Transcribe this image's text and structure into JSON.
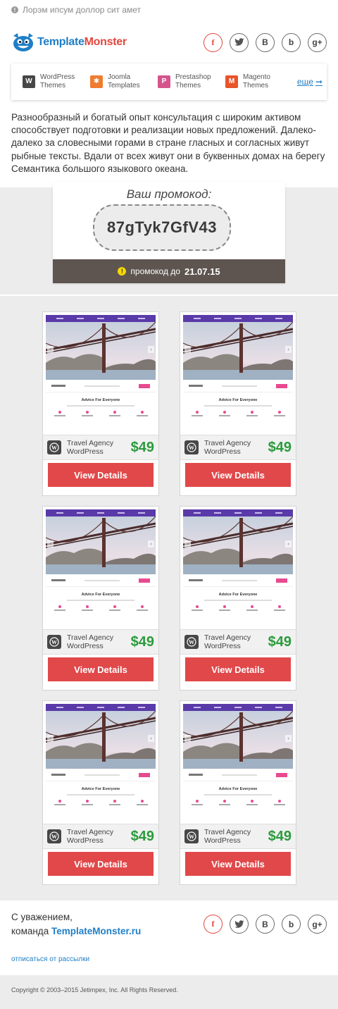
{
  "top_bar": {
    "text": "Лорэм ипсум доллор сит амет",
    "icon": "info-icon"
  },
  "brand": {
    "logo_part1": "Template",
    "logo_part2": "Monster",
    "colors": {
      "blue": "#1f7ec7",
      "red": "#e2463e",
      "green": "#2b9b3c",
      "button": "#e1484a"
    }
  },
  "social": [
    {
      "name": "facebook-icon",
      "glyph": "f"
    },
    {
      "name": "twitter-icon",
      "glyph": ""
    },
    {
      "name": "vk-icon",
      "glyph": "B"
    },
    {
      "name": "blogger-icon",
      "glyph": "b"
    },
    {
      "name": "google-plus-icon",
      "glyph": "g+"
    }
  ],
  "cms": {
    "items": [
      {
        "icon": "wordpress-icon",
        "line1": "WordPress",
        "line2": "Themes"
      },
      {
        "icon": "joomla-icon",
        "line1": "Joomla",
        "line2": "Templates"
      },
      {
        "icon": "prestashop-icon",
        "line1": "Prestashop",
        "line2": "Themes"
      },
      {
        "icon": "magento-icon",
        "line1": "Magento",
        "line2": "Themes"
      }
    ],
    "more_label": "еще"
  },
  "intro_text": "Разнообразный и богатый опыт консультация с широким активом способствует подготовки и реализации новых предложений. Далеко-далеко за словесными горами в стране гласных и согласных живут рыбные тексты. Вдали от всех живут они в буквенных домах на берегу Семантика большого языкового океана.",
  "promo": {
    "label": "Ваш промокод:",
    "code": "87gTyk7GfV43",
    "valid_prefix": "промокод до",
    "valid_date": "21.07.15"
  },
  "thumb_text": {
    "title": "Advice For Everyone"
  },
  "products": [
    {
      "name_line1": "Travel Agency",
      "name_line2": "WordPress",
      "price": "$49",
      "button": "View Details"
    },
    {
      "name_line1": "Travel Agency",
      "name_line2": "WordPress",
      "price": "$49",
      "button": "View Details"
    },
    {
      "name_line1": "Travel Agency",
      "name_line2": "WordPress",
      "price": "$49",
      "button": "View Details"
    },
    {
      "name_line1": "Travel Agency",
      "name_line2": "WordPress",
      "price": "$49",
      "button": "View Details"
    },
    {
      "name_line1": "Travel Agency",
      "name_line2": "WordPress",
      "price": "$49",
      "button": "View Details"
    },
    {
      "name_line1": "Travel Agency",
      "name_line2": "WordPress",
      "price": "$49",
      "button": "View Details"
    }
  ],
  "signature": {
    "line1": "С уважением,",
    "line2_prefix": "команда ",
    "brand": "TemplateMonster",
    "domain": ".ru"
  },
  "unsubscribe": "отписаться от рассылки",
  "copyright": "Copyright © 2003–2015 Jetimpex, Inc. All Rights Reserved."
}
